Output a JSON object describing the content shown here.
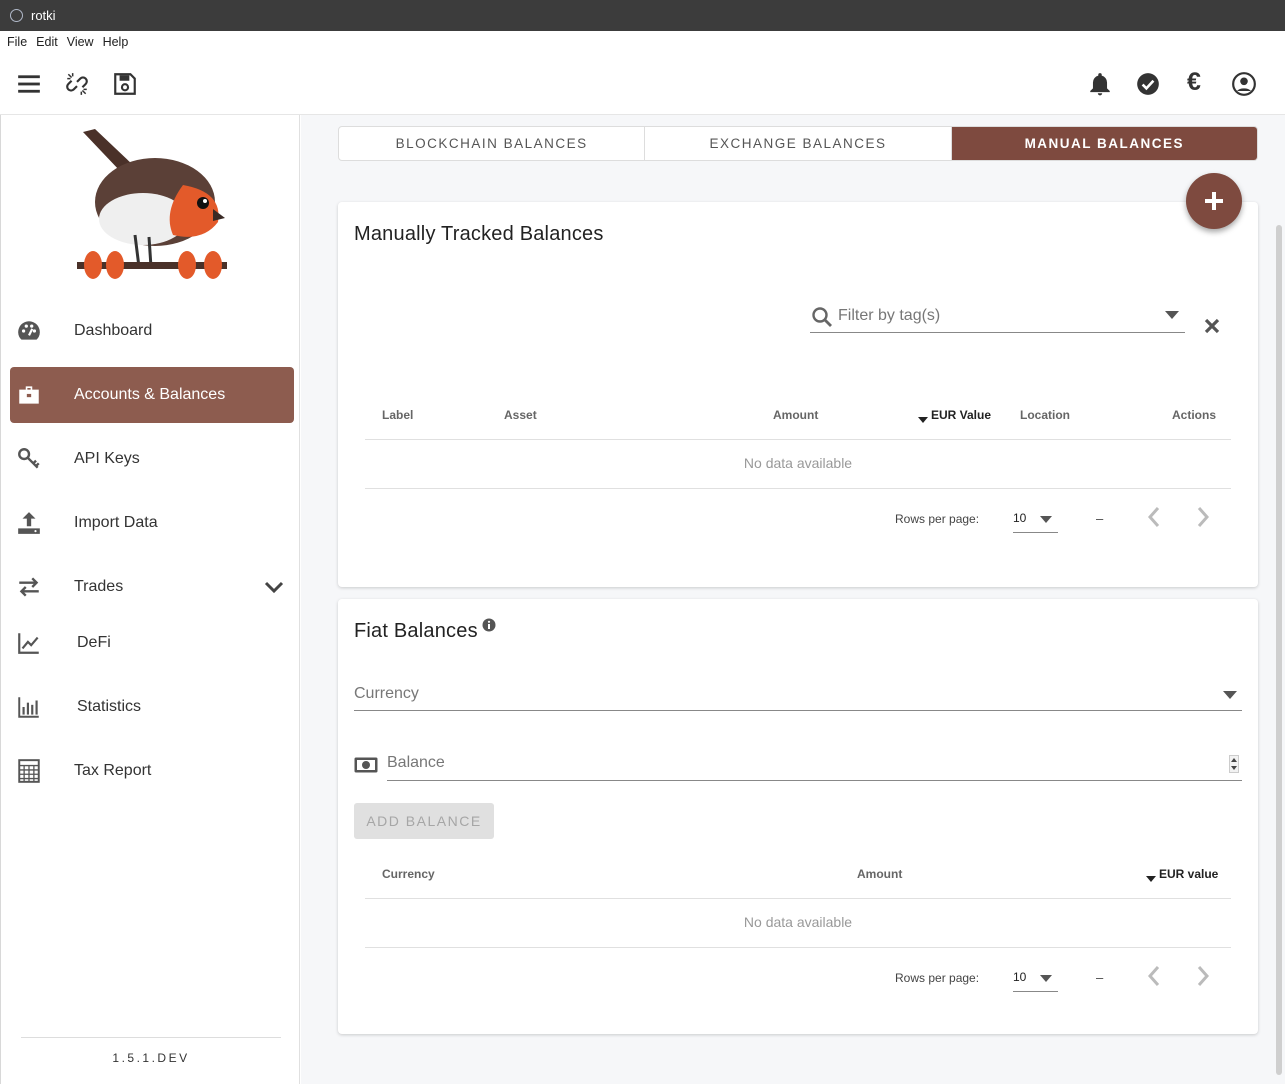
{
  "window": {
    "title": "rotki"
  },
  "menu": {
    "file": "File",
    "edit": "Edit",
    "view": "View",
    "help": "Help"
  },
  "appbar": {
    "currency_symbol": "€"
  },
  "sidebar": {
    "items": [
      {
        "label": "Dashboard",
        "icon": "dashboard-icon"
      },
      {
        "label": "Accounts & Balances",
        "icon": "briefcase-icon",
        "active": true
      },
      {
        "label": "API Keys",
        "icon": "key-icon"
      },
      {
        "label": "Import Data",
        "icon": "upload-icon"
      },
      {
        "label": "Trades",
        "icon": "swap-icon"
      },
      {
        "label": "DeFi",
        "icon": "chart-line-icon"
      },
      {
        "label": "Statistics",
        "icon": "bar-chart-icon"
      },
      {
        "label": "Tax Report",
        "icon": "calculator-icon"
      }
    ],
    "version": "1.5.1.DEV"
  },
  "tabs": [
    {
      "label": "BLOCKCHAIN BALANCES"
    },
    {
      "label": "EXCHANGE BALANCES"
    },
    {
      "label": "MANUAL BALANCES",
      "active": true
    }
  ],
  "manual": {
    "title": "Manually Tracked Balances",
    "filter_placeholder": "Filter by tag(s)",
    "columns": {
      "label": "Label",
      "asset": "Asset",
      "amount": "Amount",
      "eur_value": "EUR Value",
      "location": "Location",
      "actions": "Actions"
    },
    "empty": "No data available",
    "rows_per_page_label": "Rows per page:",
    "rows_per_page": "10",
    "range": "–"
  },
  "fiat": {
    "title": "Fiat Balances",
    "currency_placeholder": "Currency",
    "balance_placeholder": "Balance",
    "add_button": "ADD BALANCE",
    "columns": {
      "currency": "Currency",
      "amount": "Amount",
      "eur_value": "EUR value"
    },
    "empty": "No data available",
    "rows_per_page_label": "Rows per page:",
    "rows_per_page": "10",
    "range": "–"
  },
  "colors": {
    "accent": "#7e4a3f",
    "active_nav": "#8d5c4f"
  }
}
